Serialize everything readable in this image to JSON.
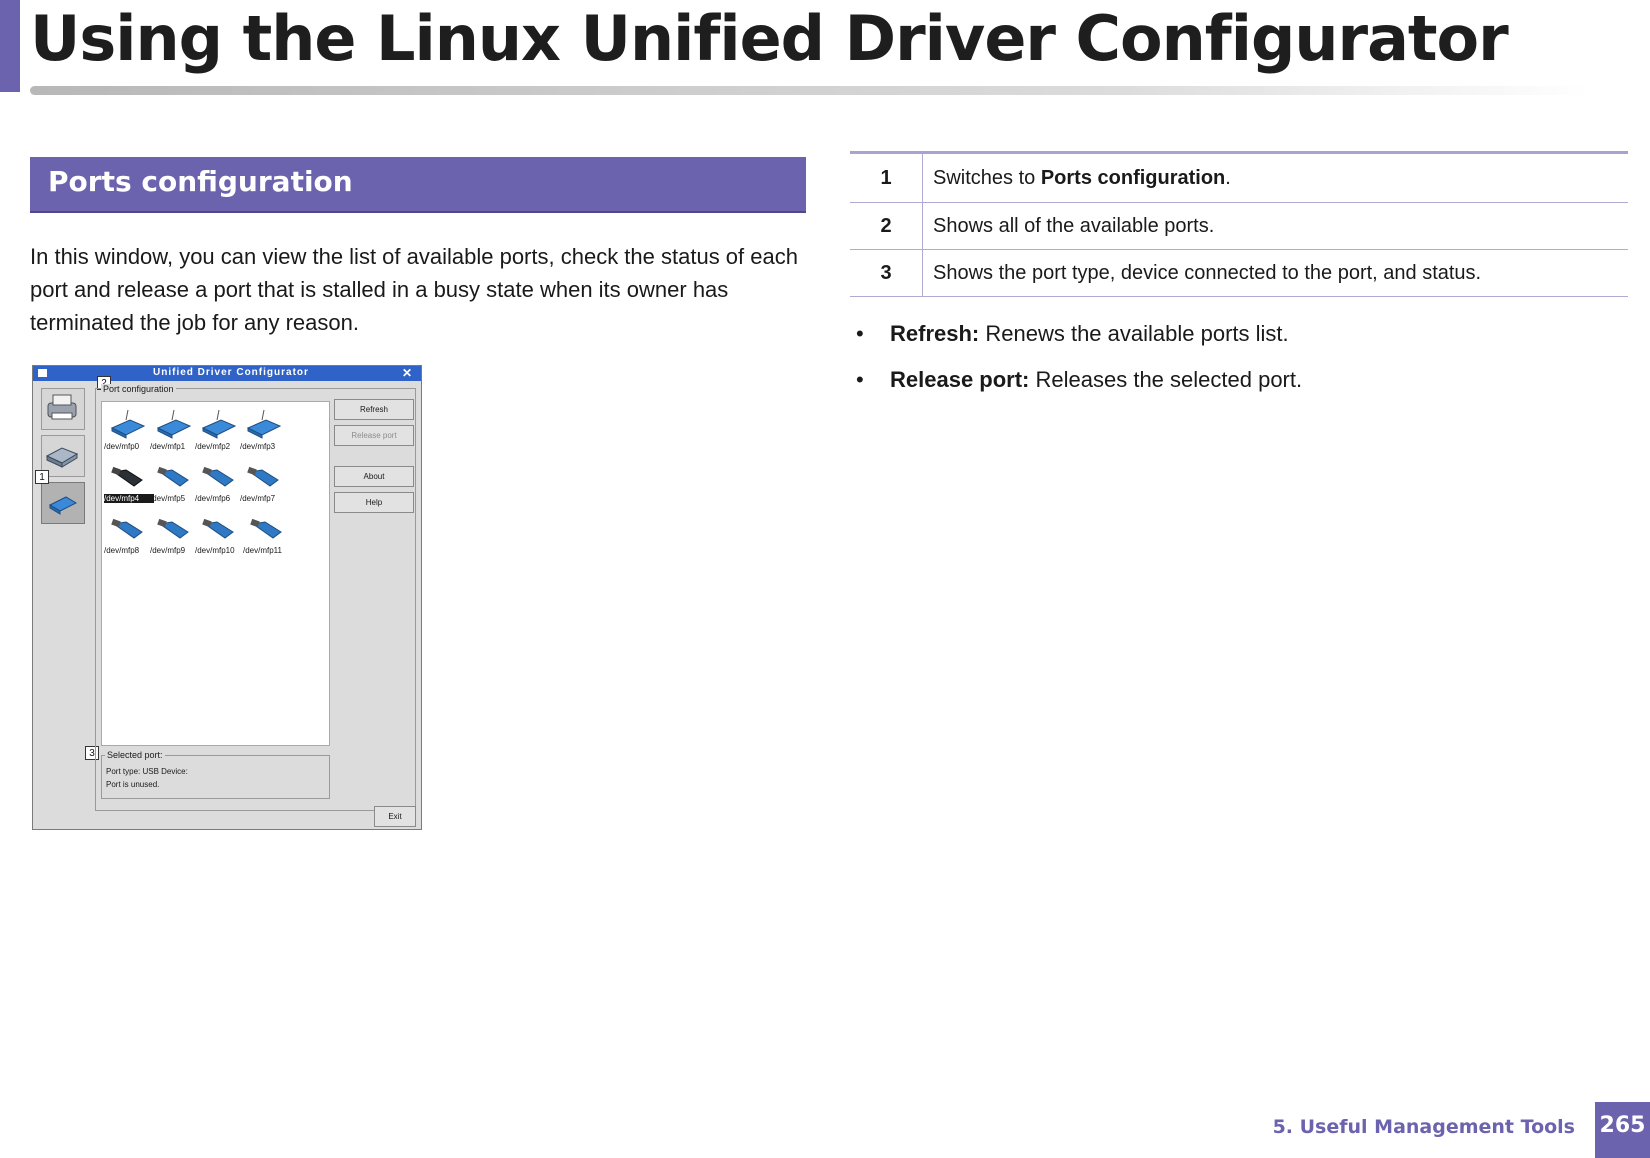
{
  "page_title": "Using the Linux Unified Driver Configurator",
  "section_title": "Ports configuration",
  "intro_text": "In this window, you can view the list of available ports, check the status of each port and release a port that is stalled in a busy state when its owner has terminated the job for any reason.",
  "screenshot": {
    "window_title": "Unified Driver Configurator",
    "close_glyph": "✕",
    "frame_label": "Port configuration",
    "callouts": [
      "1",
      "2",
      "3"
    ],
    "ports": [
      "/dev/mfp0",
      "/dev/mfp1",
      "/dev/mfp2",
      "/dev/mfp3",
      "/dev/mfp4",
      "/dev/mfp5",
      "/dev/mfp6",
      "/dev/mfp7",
      "/dev/mfp8",
      "/dev/mfp9",
      "/dev/mfp10",
      "/dev/mfp11"
    ],
    "selected_port": "/dev/mfp4",
    "buttons": {
      "refresh": "Refresh",
      "release_port": "Release port",
      "about": "About",
      "help": "Help",
      "exit": "Exit"
    },
    "selected_port_label": "Selected port:",
    "port_type_line": "Port type: USB   Device:",
    "status_line": "Port is unused.",
    "icons": [
      "printer-icon",
      "scanner-icon",
      "port-icon"
    ]
  },
  "table": [
    {
      "num": "1",
      "text_before": "Switches to ",
      "text_bold": "Ports configuration",
      "text_after": "."
    },
    {
      "num": "2",
      "text_before": "Shows all of the available ports.",
      "text_bold": "",
      "text_after": ""
    },
    {
      "num": "3",
      "text_before": "Shows the port type, device connected to the port, and status.",
      "text_bold": "",
      "text_after": ""
    }
  ],
  "bullets": [
    {
      "label": "Refresh:",
      "text": " Renews the available ports list."
    },
    {
      "label": "Release port:",
      "text": " Releases the selected port."
    }
  ],
  "bullet_glyph": "•",
  "footer": {
    "chapter": "5.  Useful Management Tools",
    "page_number": "265"
  },
  "colors": {
    "accent": "#6b63ad",
    "titlebar": "#2f63c8"
  }
}
